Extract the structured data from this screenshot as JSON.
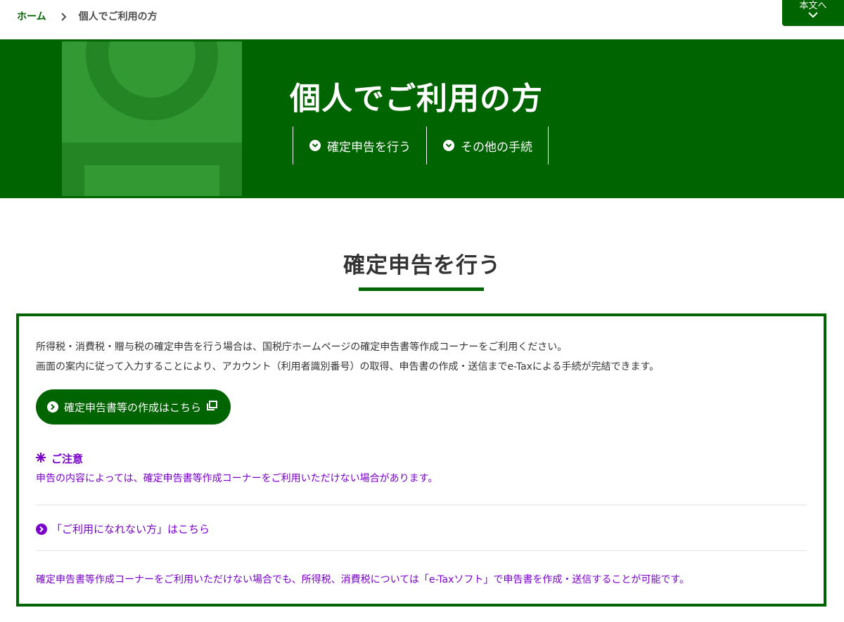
{
  "breadcrumb": {
    "home": "ホーム",
    "current": "個人でご利用の方"
  },
  "skip_link": {
    "label": "本文へ"
  },
  "hero": {
    "title": "個人でご利用の方",
    "nav": [
      {
        "label": "確定申告を行う"
      },
      {
        "label": "その他の手続"
      }
    ]
  },
  "section": {
    "title": "確定申告を行う",
    "intro_lines": [
      "所得税・消費税・贈与税の確定申告を行う場合は、国税庁ホームページの確定申告書等作成コーナーをご利用ください。",
      "画面の案内に従って入力することにより、アカウント（利用者識別番号）の取得、申告書の作成・送信までe-Taxによる手続が完結できます。"
    ],
    "cta_label": "確定申告書等の作成はこちら",
    "notice_title": "ご注意",
    "notice_text": "申告の内容によっては、確定申告書等作成コーナーをご利用いただけない場合があります。",
    "link_label": "「ご利用になれない方」はこちら",
    "bottom_text": "確定申告書等作成コーナーをご利用いただけない場合でも、所得税、消費税については「e-Taxソフト」で申告書を作成・送信することが可能です。"
  },
  "colors": {
    "brand_green": "#006400",
    "notice_purple": "#7a00cc"
  }
}
